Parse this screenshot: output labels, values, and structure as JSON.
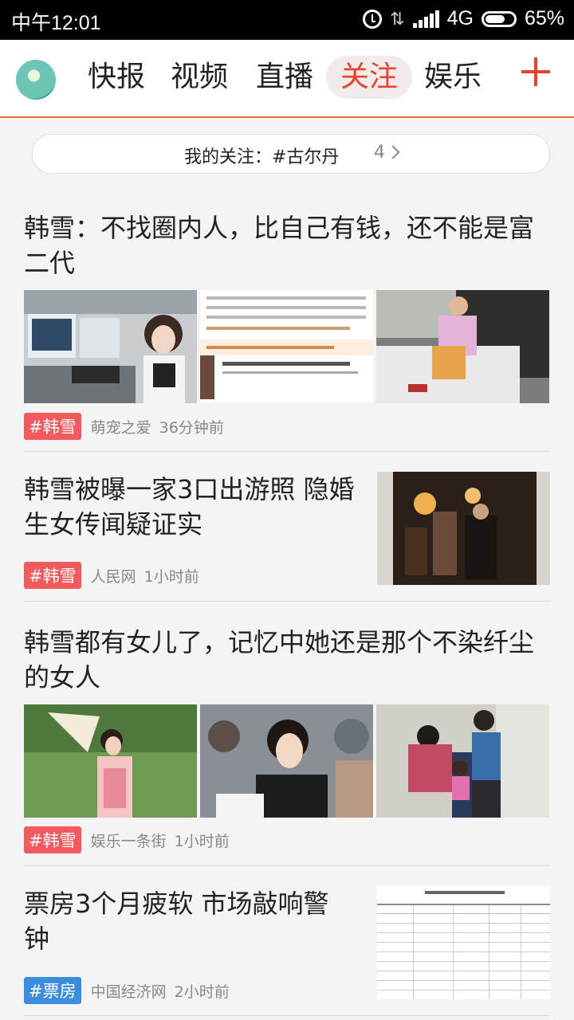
{
  "status_bar": {
    "time": "中午12:01",
    "network": "4G",
    "battery": "65%"
  },
  "nav": {
    "tabs": [
      "快报",
      "视频",
      "直播",
      "关注",
      "娱乐"
    ],
    "active_tab": "关注"
  },
  "follow_bar": {
    "label": "我的关注：#古尔丹",
    "count": "4"
  },
  "colors": {
    "accent": "#e5452f",
    "tag_red": "#f35a5d",
    "tag_blue": "#3d8dde"
  },
  "articles": [
    {
      "title": "韩雪：不找圈内人，比自己有钱，还不能是富二代",
      "tag": "#韩雪",
      "source": "萌宠之爱",
      "time": "36分钟前"
    },
    {
      "title": "韩雪被曝一家3口出游照 隐婚生女传闻疑证实",
      "tag": "#韩雪",
      "source": "人民网",
      "time": "1小时前"
    },
    {
      "title": "韩雪都有女儿了，记忆中她还是那个不染纤尘的女人",
      "tag": "#韩雪",
      "source": "娱乐一条街",
      "time": "1小时前"
    },
    {
      "title": "票房3个月疲软 市场敲响警钟",
      "tag": "#票房",
      "source": "中国经济网",
      "time": "2小时前"
    }
  ]
}
